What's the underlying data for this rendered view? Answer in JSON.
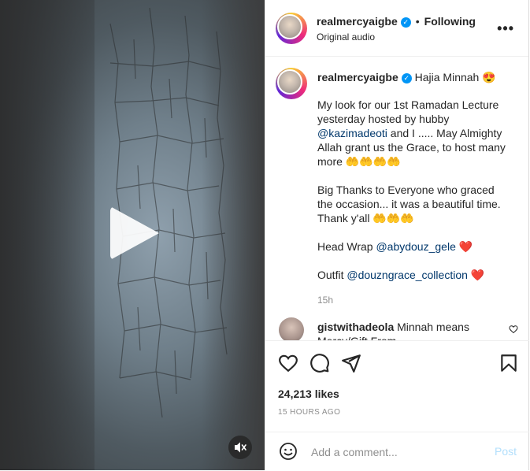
{
  "header": {
    "username": "realmercyaigbe",
    "separator": "•",
    "follow_label": "Following",
    "audio": "Original audio",
    "more_label": "•••"
  },
  "caption": {
    "username": "realmercyaigbe",
    "headline": "Hajia Minnah 😍",
    "para1_text": "My look for our 1st Ramadan Lecture yesterday hosted by hubby",
    "para1_mention": "@kazimadeoti",
    "para1_rest": " and I ..... May Almighty Allah grant us the Grace, to host many more 🤲🤲🤲🤲",
    "para2": "Big Thanks to Everyone who graced the occasion... it was a beautiful time. Thank y'all 🤲🤲🤲",
    "headwrap_label": "Head Wrap ",
    "headwrap_mention": "@abydouz_gele",
    "outfit_label": "Outfit ",
    "outfit_mention": "@douzngrace_collection",
    "heart": "❤️",
    "time": "15h"
  },
  "comment": {
    "username": "gistwithadeola",
    "text": " Minnah means Mercy/Gift From"
  },
  "stats": {
    "likes": "24,213 likes",
    "posted": "15 HOURS AGO"
  },
  "composer": {
    "placeholder": "Add a comment...",
    "post_label": "Post"
  },
  "icons": [
    "play-icon",
    "mute-icon",
    "verified-icon",
    "more-icon",
    "heart-icon",
    "comment-icon",
    "share-icon",
    "bookmark-icon",
    "emoji-icon"
  ],
  "colors": {
    "verified": "#0095f6",
    "link": "#00376b",
    "post_disabled": "#b2dffc",
    "heart": "#e0102c"
  }
}
